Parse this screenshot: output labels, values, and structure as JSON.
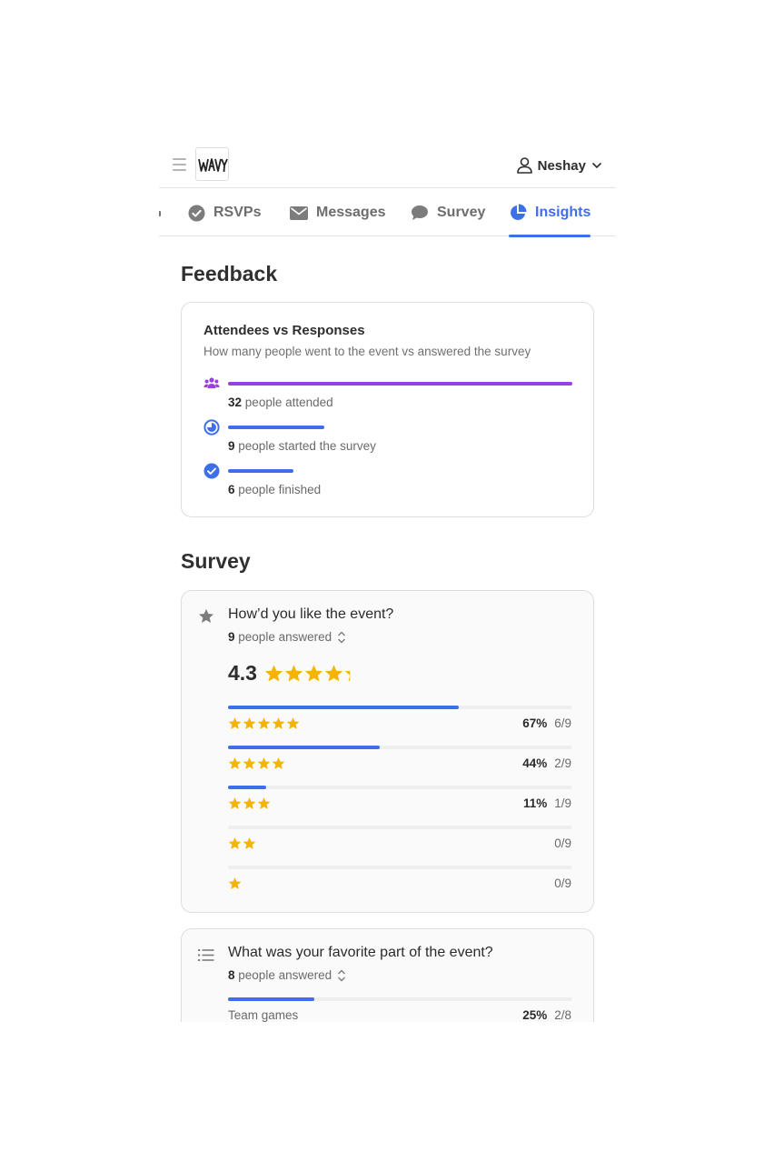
{
  "header": {
    "logo_text": "WAVY",
    "user_name": "Neshay"
  },
  "tabs": [
    {
      "label": "RSVPs",
      "icon": "check-circle-icon"
    },
    {
      "label": "Messages",
      "icon": "envelope-icon"
    },
    {
      "label": "Survey",
      "icon": "chat-bubble-icon"
    },
    {
      "label": "Insights",
      "icon": "pie-chart-icon",
      "active": true
    }
  ],
  "feedback": {
    "heading": "Feedback",
    "card_title": "Attendees vs Responses",
    "card_subtitle": "How many people went to the event vs answered the survey",
    "stats": [
      {
        "count": "32",
        "text": "people attended",
        "fraction": 1.0,
        "color": "#9a3fe3",
        "icon": "people-icon"
      },
      {
        "count": "9",
        "text": "people started the survey",
        "fraction": 0.28,
        "color": "#3f6fe8",
        "icon": "progress-circle-icon"
      },
      {
        "count": "6",
        "text": "people finished",
        "fraction": 0.19,
        "color": "#3f6fe8",
        "icon": "check-badge-icon"
      }
    ]
  },
  "survey": {
    "heading": "Survey",
    "q1": {
      "title": "How’d you like the event?",
      "answered_count": "9",
      "answered_text": "people answered",
      "average": "4.3",
      "average_stars": 4.3,
      "rows": [
        {
          "stars": 5,
          "percent": "67%",
          "ratio": "6/9",
          "fraction": 0.67
        },
        {
          "stars": 4,
          "percent": "44%",
          "ratio": "2/9",
          "fraction": 0.44
        },
        {
          "stars": 3,
          "percent": "11%",
          "ratio": "1/9",
          "fraction": 0.11
        },
        {
          "stars": 2,
          "percent": "",
          "ratio": "0/9",
          "fraction": 0
        },
        {
          "stars": 1,
          "percent": "",
          "ratio": "0/9",
          "fraction": 0
        }
      ]
    },
    "q2": {
      "title": "What was your favorite part of the event?",
      "answered_count": "8",
      "answered_text": "people answered",
      "options": [
        {
          "label": "Team games",
          "percent": "25%",
          "ratio": "2/8",
          "fraction": 0.25
        }
      ]
    }
  },
  "colors": {
    "accent": "#3f6fe8",
    "purple": "#9a3fe3",
    "star": "#f5b400"
  }
}
